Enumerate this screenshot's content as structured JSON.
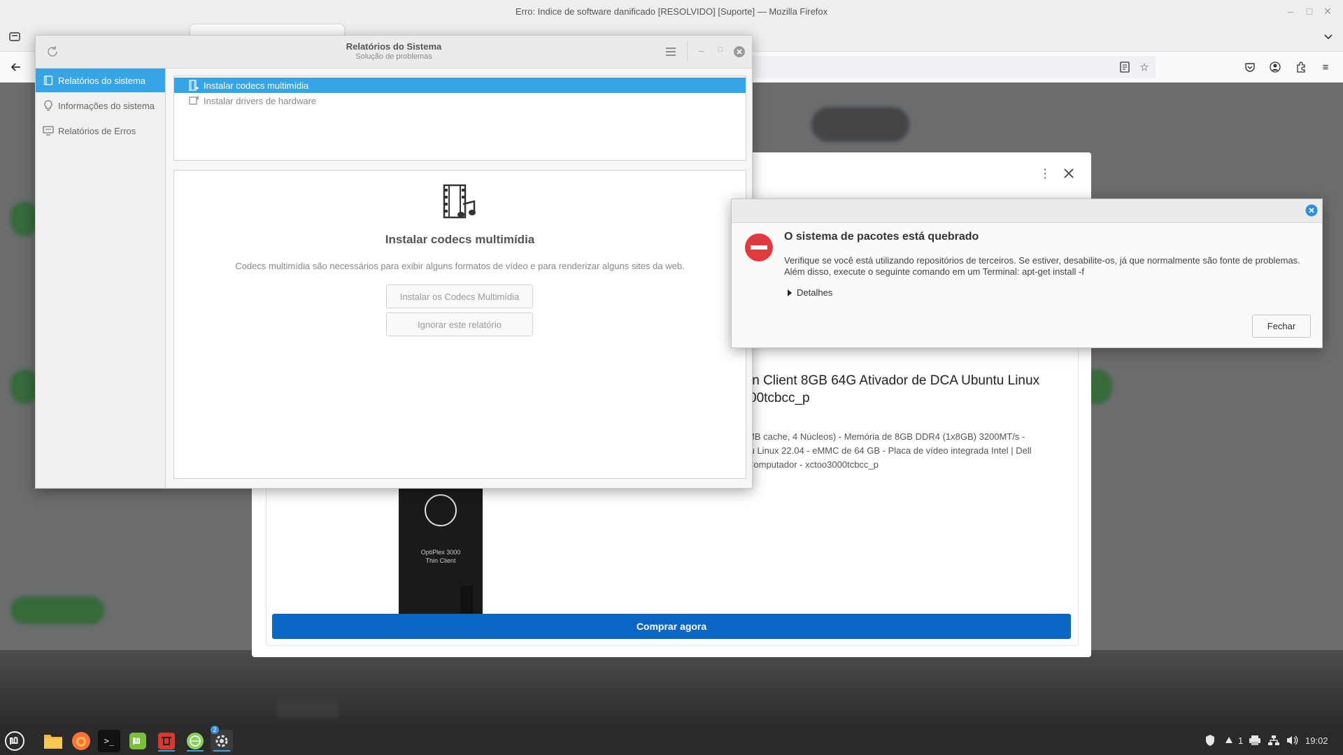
{
  "firefox": {
    "window_title": "Erro: Indice de software danificado [RESOLVIDO] [Suporte] — Mozilla Firefox"
  },
  "product": {
    "title_line1": "in Client 8GB 64G Ativador de DCA Ubuntu Linux",
    "title_line2": "00tcbcc_p",
    "desc_line1": "MB cache, 4 Núcleos) - Memória de 8GB DDR4 (1x8GB) 3200MT/s -",
    "desc_line2": "tu Linux 22.04 - eMMC de 64 GB - Placa de vídeo integrada Intel | Dell",
    "desc_line3": "Computador - xctoo3000tcbcc_p",
    "device_label_line1": "OptiPlex 3000",
    "device_label_line2": "Thin Client",
    "buy_label": "Comprar agora"
  },
  "system_reports": {
    "title": "Relatórios do Sistema",
    "subtitle": "Solução de problemas",
    "sidebar": [
      {
        "label": "Relatórios do sistema"
      },
      {
        "label": "Informações do sistema"
      },
      {
        "label": "Relatórios de Erros"
      }
    ],
    "reports": [
      {
        "label": "Instalar codecs multimídia"
      },
      {
        "label": "Instalar drivers de hardware"
      }
    ],
    "detail": {
      "title": "Instalar codecs multimídia",
      "description": "Codecs multimídia são necessários para exibir alguns formatos de vídeo e para renderizar alguns sites da web.",
      "install_button": "Instalar os Codecs Multimídia",
      "ignore_button": "Ignorar este relatório"
    }
  },
  "error_dialog": {
    "title": "O sistema de pacotes está quebrado",
    "message_line1": "Verifique se você está utilizando repositórios de terceiros. Se estiver, desabilite-os, já que normalmente são fonte de problemas.",
    "message_line2": "Além disso, execute o seguinte comando em um Terminal: apt-get install -f",
    "details_label": "Detalhes",
    "close_button": "Fechar"
  },
  "taskbar": {
    "update_badge": "2",
    "workspace_count": "1",
    "clock": "19:02"
  },
  "colors": {
    "accent": "#35a5e5",
    "buy_button": "#0a66c2",
    "error_icon": "#e0393e"
  }
}
